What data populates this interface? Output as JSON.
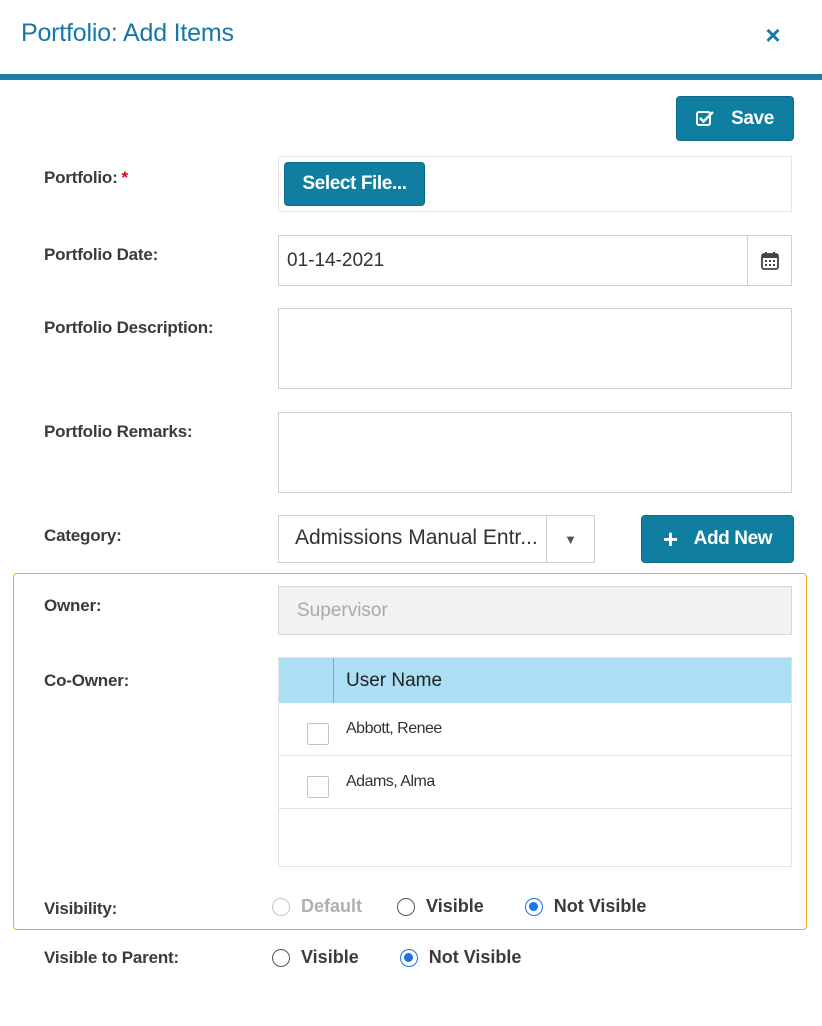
{
  "dialog": {
    "title": "Portfolio: Add Items",
    "close_icon": "×"
  },
  "toolbar": {
    "save_label": "Save"
  },
  "form": {
    "portfolio_label": "Portfolio:",
    "required_mark": "*",
    "select_file_label": "Select File...",
    "date_label": "Portfolio Date:",
    "date_value": "01-14-2021",
    "description_label": "Portfolio Description:",
    "remarks_label": "Portfolio Remarks:",
    "category_label": "Category:",
    "category_value": "Admissions Manual Entr...",
    "add_new_plus": "+",
    "add_new_label": "Add New",
    "owner_label": "Owner:",
    "owner_value": "Supervisor",
    "co_owner_label": "Co-Owner:",
    "co_owner_grid": {
      "column_header": "User Name",
      "rows": [
        {
          "name": "Abbott, Renee",
          "checked": false
        },
        {
          "name": "Adams, Alma",
          "checked": false
        }
      ]
    },
    "visibility_label": "Visibility:",
    "visibility_options": [
      {
        "label": "Default",
        "state": "disabled"
      },
      {
        "label": "Visible",
        "state": "unchecked"
      },
      {
        "label": "Not Visible",
        "state": "checked"
      }
    ],
    "visible_to_parent_label": "Visible to Parent:",
    "visible_to_parent_options": [
      {
        "label": "Visible",
        "state": "unchecked"
      },
      {
        "label": "Not Visible",
        "state": "checked"
      }
    ]
  },
  "colors": {
    "accent": "#107ea0",
    "title": "#1578a6",
    "panel_border": "#f0ad1e",
    "grid_header": "#acdff3",
    "required": "#d0021b",
    "radio_checked": "#1a73e8"
  },
  "icons": {
    "save": "check-square-icon",
    "calendar": "calendar-icon",
    "dropdown": "caret-down-icon",
    "close": "close-icon",
    "add": "plus-icon"
  }
}
